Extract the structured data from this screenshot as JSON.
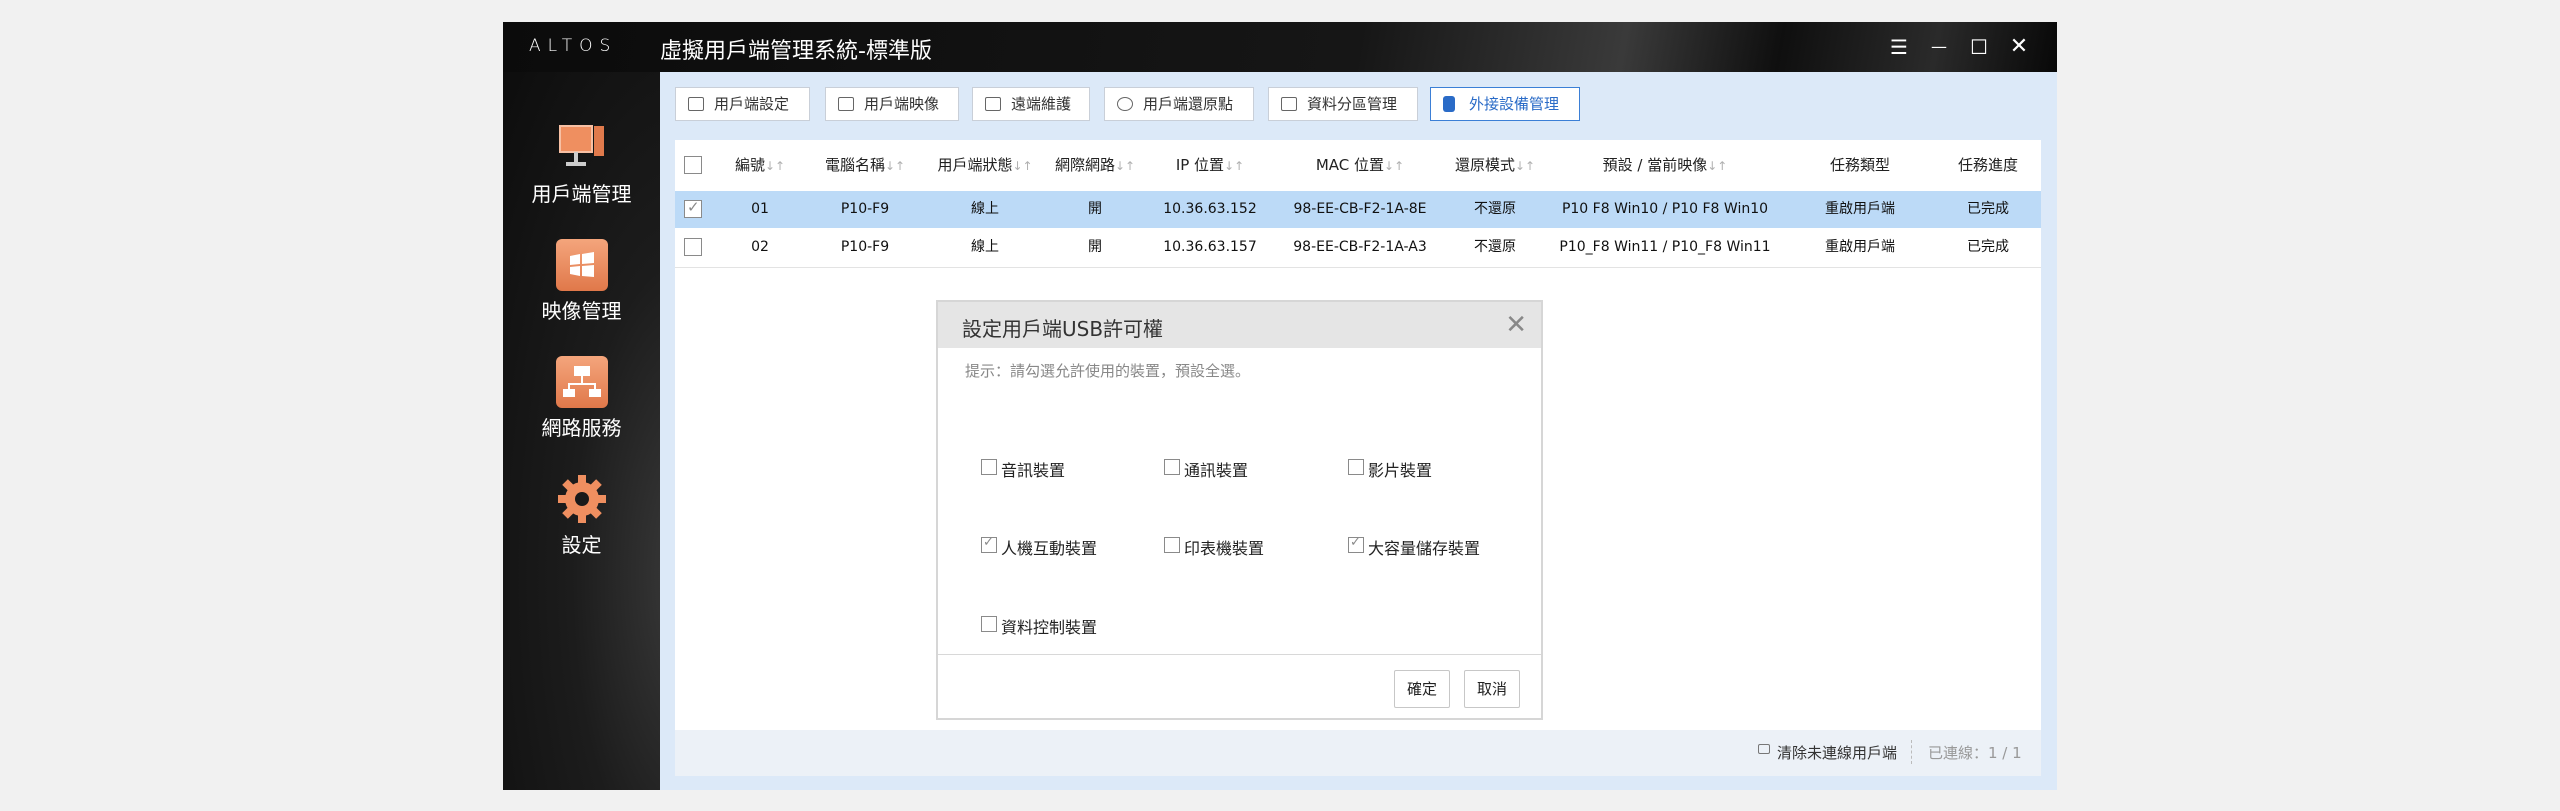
{
  "titlebar": {
    "brand": "ALTOS",
    "title": "虛擬用戶端管理系統-標準版",
    "menu_glyph": "☰",
    "min_glyph": "—",
    "max_glyph": "☐",
    "close_glyph": "✕"
  },
  "sidebar": {
    "items": [
      {
        "label": "用戶端管理",
        "icon": "client-monitor-icon"
      },
      {
        "label": "映像管理",
        "icon": "windows-image-icon"
      },
      {
        "label": "網路服務",
        "icon": "network-icon"
      },
      {
        "label": "設定",
        "icon": "gear-icon"
      }
    ]
  },
  "toolbar": {
    "buttons": [
      {
        "label": "用戶端設定",
        "icon": "client-settings-icon"
      },
      {
        "label": "用戶端映像",
        "icon": "client-image-icon"
      },
      {
        "label": "遠端維護",
        "icon": "remote-icon"
      },
      {
        "label": "用戶端還原點",
        "icon": "restore-icon"
      },
      {
        "label": "資料分區管理",
        "icon": "disk-icon"
      },
      {
        "label": "外接設備管理",
        "icon": "usb-icon",
        "active": true
      }
    ]
  },
  "table": {
    "sort_glyph": "↓↑",
    "columns": [
      "編號",
      "電腦名稱",
      "用戶端狀態",
      "網際網路",
      "IP 位置",
      "MAC 位置",
      "還原模式",
      "預設 / 當前映像",
      "任務類型",
      "任務進度"
    ],
    "rows": [
      {
        "selected": true,
        "cells": [
          "01",
          "P10-F9",
          "線上",
          "開",
          "10.36.63.152",
          "98-EE-CB-F2-1A-8E",
          "不還原",
          "P10 F8 Win10 / P10 F8 Win10",
          "重啟用戶端",
          "已完成"
        ]
      },
      {
        "selected": false,
        "cells": [
          "02",
          "P10-F9",
          "線上",
          "開",
          "10.36.63.157",
          "98-EE-CB-F2-1A-A3",
          "不還原",
          "P10_F8 Win11 / P10_F8 Win11",
          "重啟用戶端",
          "已完成"
        ]
      }
    ]
  },
  "statusbar": {
    "clear_label": "清除未連線用戶端",
    "connected_label": "已連線：1 / 1"
  },
  "dialog": {
    "title": "設定用戶端USB許可權",
    "close_glyph": "✕",
    "hint": "提示：請勾選允許使用的裝置，預設全選。",
    "devices": [
      {
        "label": "音訊裝置",
        "checked": false
      },
      {
        "label": "通訊裝置",
        "checked": false
      },
      {
        "label": "影片裝置",
        "checked": false
      },
      {
        "label": "人機互動裝置",
        "checked": true
      },
      {
        "label": "印表機裝置",
        "checked": false
      },
      {
        "label": "大容量儲存裝置",
        "checked": true
      },
      {
        "label": "資料控制裝置",
        "checked": false
      }
    ],
    "ok_label": "確定",
    "cancel_label": "取消"
  }
}
